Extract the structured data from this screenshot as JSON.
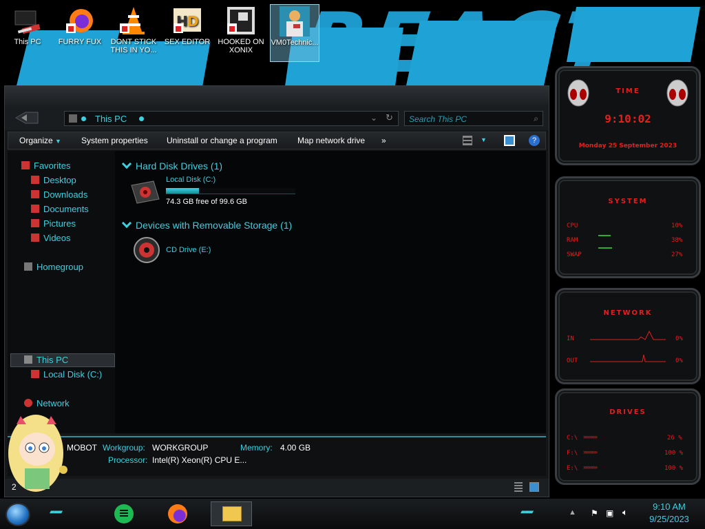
{
  "desktop": {
    "icons": [
      {
        "label": "This PC",
        "icon": "computer-icon"
      },
      {
        "label": "FURRY FUX",
        "icon": "firefox-icon"
      },
      {
        "label": "DONT STICK THIS IN YO...",
        "icon": "vlc-cone-icon"
      },
      {
        "label": "SEX EDITOR",
        "icon": "hxd-editor-icon"
      },
      {
        "label": "HOOKED ON XONIX",
        "icon": "game-icon"
      },
      {
        "label": "VM0Technic...",
        "icon": "user-avatar-icon"
      }
    ],
    "wallpaper_text": "REACT"
  },
  "explorer": {
    "address": "This PC",
    "search_placeholder": "Search This PC",
    "toolbar": {
      "organize": "Organize",
      "system_properties": "System properties",
      "uninstall": "Uninstall or change a program",
      "map_drive": "Map network drive",
      "more": "»"
    },
    "nav": {
      "favorites": "Favorites",
      "desktop": "Desktop",
      "downloads": "Downloads",
      "documents": "Documents",
      "pictures": "Pictures",
      "videos": "Videos",
      "homegroup": "Homegroup",
      "this_pc": "This PC",
      "local_disk": "Local Disk (C:)",
      "network": "Network"
    },
    "groups": {
      "hdd_header": "Hard Disk Drives (1)",
      "removable_header": "Devices with Removable Storage (1)"
    },
    "drives": {
      "c_label": "Local Disk (C:)",
      "c_free": "74.3 GB free of 99.6 GB",
      "c_used_fraction": 0.254,
      "e_label": "CD Drive (E:)"
    },
    "details": {
      "name": "MOBOT",
      "workgroup_label": "Workgroup:",
      "workgroup_value": "WORKGROUP",
      "memory_label": "Memory:",
      "memory_value": "4.00 GB",
      "processor_label": "Processor:",
      "processor_value": "Intel(R) Xeon(R) CPU E..."
    },
    "status_count": "2"
  },
  "gadgets": {
    "time": {
      "title": "TIME",
      "clock": "9:10:02",
      "date": "Monday 25 September 2023"
    },
    "system": {
      "title": "SYSTEM",
      "rows": [
        {
          "label": "CPU",
          "value": "10%"
        },
        {
          "label": "RAM",
          "value": "38%"
        },
        {
          "label": "SWAP",
          "value": "27%"
        }
      ]
    },
    "network": {
      "title": "NETWORK",
      "rows": [
        {
          "label": "IN",
          "value": "0%"
        },
        {
          "label": "OUT",
          "value": "0%"
        }
      ]
    },
    "drives": {
      "title": "DRIVES",
      "rows": [
        {
          "label": "C:\\",
          "value": "26 %"
        },
        {
          "label": "F:\\",
          "value": "100 %"
        },
        {
          "label": "E:\\",
          "value": "100 %"
        }
      ]
    }
  },
  "taskbar": {
    "time": "9:10 AM",
    "date": "9/25/2023"
  },
  "colors": {
    "accent": "#3fd0e0",
    "gadget_red": "#e61e1e",
    "wallpaper_blue": "#1fa3d6"
  }
}
